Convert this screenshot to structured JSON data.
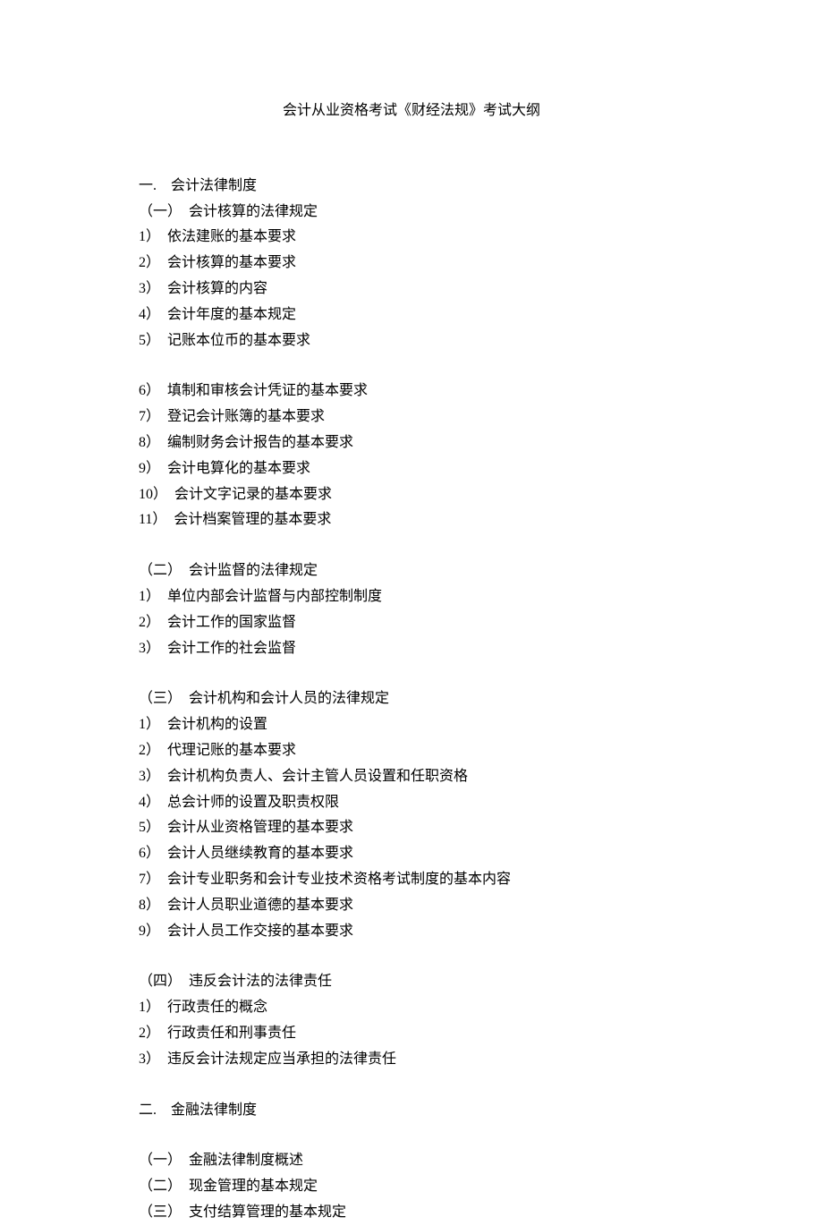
{
  "title": "会计从业资格考试《财经法规》考试大纲",
  "section1": {
    "heading": "一.　会计法律制度",
    "sub1": {
      "heading": "（一）　会计核算的法律规定",
      "items_a": [
        "1）　依法建账的基本要求",
        "2）　会计核算的基本要求",
        "3）　会计核算的内容",
        "4）　会计年度的基本规定",
        "5）　记账本位币的基本要求"
      ],
      "items_b": [
        "6）　填制和审核会计凭证的基本要求",
        "7）　登记会计账簿的基本要求",
        "8）　编制财务会计报告的基本要求",
        "9）　会计电算化的基本要求",
        "10）　会计文字记录的基本要求",
        "11）　会计档案管理的基本要求"
      ]
    },
    "sub2": {
      "heading": "（二）　会计监督的法律规定",
      "items": [
        "1）　单位内部会计监督与内部控制制度",
        "2）　会计工作的国家监督",
        "3）　会计工作的社会监督"
      ]
    },
    "sub3": {
      "heading": "（三）　会计机构和会计人员的法律规定",
      "items": [
        "1）　会计机构的设置",
        "2）　代理记账的基本要求",
        "3）　会计机构负责人、会计主管人员设置和任职资格",
        "4）　总会计师的设置及职责权限",
        "5）　会计从业资格管理的基本要求",
        "6）　会计人员继续教育的基本要求",
        "7）　会计专业职务和会计专业技术资格考试制度的基本内容",
        "8）　会计人员职业道德的基本要求",
        "9）　会计人员工作交接的基本要求"
      ]
    },
    "sub4": {
      "heading": "（四）　违反会计法的法律责任",
      "items": [
        "1）　行政责任的概念",
        "2）　行政责任和刑事责任",
        "3）　违反会计法规定应当承担的法律责任"
      ]
    }
  },
  "section2": {
    "heading": "二.　金融法律制度",
    "items": [
      "（一）　金融法律制度概述",
      "（二）　现金管理的基本规定",
      "（三）　支付结算管理的基本规定"
    ]
  }
}
